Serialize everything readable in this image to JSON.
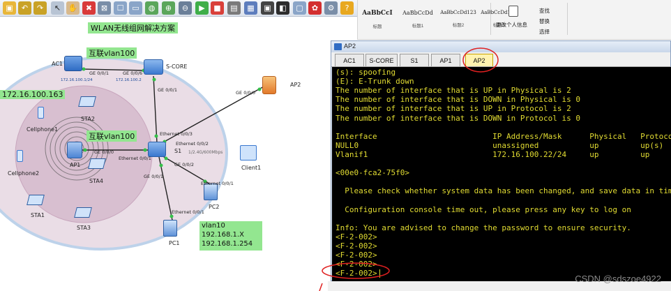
{
  "toolbar": {
    "icons": [
      "new-icon",
      "undo-icon",
      "redo-icon",
      "select-icon",
      "hand-icon",
      "delete-icon",
      "delete-link-icon",
      "note-icon",
      "rectangle-icon",
      "ellipse-icon",
      "zoom-in-icon",
      "zoom-out-icon",
      "fit-icon",
      "start-icon",
      "stop-icon",
      "capture-icon",
      "grid-icon",
      "topology-icon",
      "message-icon",
      "huawei-icon",
      "settings-icon",
      "help-icon"
    ]
  },
  "topology": {
    "title": "WLAN无线组网解决方案",
    "labels": {
      "vlan_top": "互联vlan100",
      "vlan_mid": "互联vlan100",
      "subnet": "172.16.100.163",
      "vlan_box": "vlan10\n192.168.1.X\n192.168.1.254"
    },
    "devices": {
      "ac1": "AC1",
      "score": "S-CORE",
      "s1": "S1",
      "ap1": "AP1",
      "ap2": "AP2",
      "pc1": "PC1",
      "pc2": "PC2",
      "client1": "Client1",
      "cellphone1": "Cellphone1",
      "cellphone2": "Cellphone2",
      "sta1": "STA1",
      "sta2": "STA2",
      "sta3": "STA3",
      "sta4": "STA4"
    },
    "ports": {
      "ac1_ge": "GE 0/0/1",
      "score_ge6": "GE 0/0/6",
      "ac1_ip": "172.16.100.1/24",
      "score_ip": "172.16.100.2",
      "score_ge1": "GE 0/0/1",
      "ap2_ge": "GE 0/0/0",
      "s1_eth3": "Ethernet 0/0/3",
      "s1_eth2": "Ethernet 0/0/2",
      "s1_eth1": "Ethernet 0/0/1",
      "s1_ge2": "GE 0/0/2",
      "s1_ge1": "GE 0/0/1",
      "ap1_ge": "GE 0/0/0",
      "pc2_eth": "Ethernet 0/0/1",
      "pc1_eth": "Ethernet 0/0/1",
      "wifi_info": "1/2.4G/600Mbps"
    }
  },
  "ribbon": {
    "styles": [
      {
        "sample": "AaBbCcI",
        "name": "标题"
      },
      {
        "sample": "AaBbCcDd",
        "name": "标题1"
      },
      {
        "sample": "AaBbCcDd123",
        "name": "标题2"
      },
      {
        "sample": "AaBbCcDd123",
        "name": "标题3"
      }
    ],
    "change_user": "更改个人信息",
    "find": "查找",
    "replace": "替换",
    "select": "选择"
  },
  "console": {
    "title": "AP2",
    "tabs": [
      "AC1",
      "S-CORE",
      "S1",
      "AP1",
      "AP2"
    ],
    "active_tab": "AP2",
    "lines": [
      "(s): spoofing",
      "(E): E-Trunk down",
      "The number of interface that is UP in Physical is 2",
      "The number of interface that is DOWN in Physical is 0",
      "The number of interface that is UP in Protocol is 2",
      "The number of interface that is DOWN in Protocol is 0",
      "",
      "Interface                         IP Address/Mask      Physical   Protocol",
      "NULL0                             unassigned           up         up(s)",
      "Vlanif1                           172.16.100.22/24     up         up",
      "",
      "<00e0-fca2-75f0>",
      "",
      "  Please check whether system data has been changed, and save data in time",
      "",
      "  Configuration console time out, please press any key to log on",
      "",
      "Info: You are advised to change the password to ensure security.",
      "<F-2-002>",
      "<F-2-002>",
      "<F-2-002>",
      "<F-2-002>",
      "<F-2-002>"
    ]
  },
  "watermark": "CSDN @sdszoe4922",
  "colors": {
    "terminal_bg": "#000000",
    "terminal_text": "#e2dc32",
    "label_green": "#93e690",
    "annotation_red": "#e02020",
    "active_tab": "#fff3b0"
  }
}
